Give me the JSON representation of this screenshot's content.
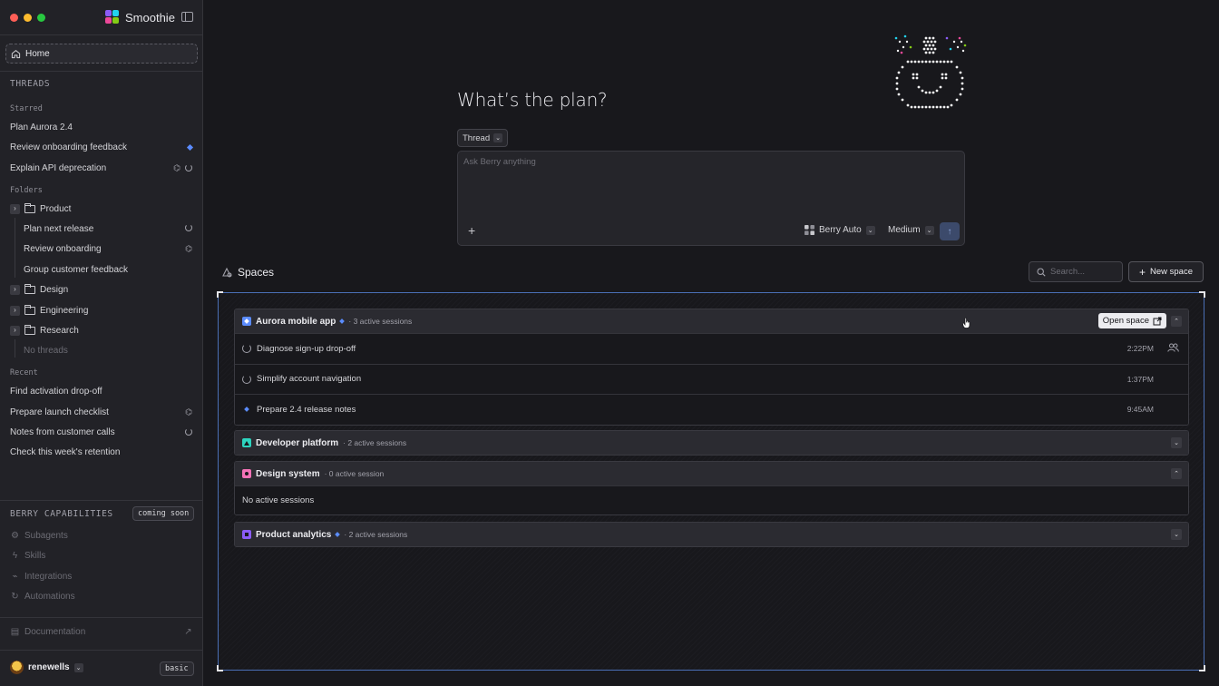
{
  "app": {
    "name": "Smoothie"
  },
  "sidebar": {
    "home_label": "Home",
    "threads_title": "THREADS",
    "starred_title": "Starred",
    "starred": [
      {
        "label": "Plan Aurora 2.4"
      },
      {
        "label": "Review onboarding feedback"
      },
      {
        "label": "Explain API deprecation"
      }
    ],
    "folders_title": "Folders",
    "folders": {
      "product": {
        "label": "Product",
        "items": [
          "Plan next release",
          "Review onboarding",
          "Group customer feedback"
        ]
      },
      "design": {
        "label": "Design"
      },
      "engineering": {
        "label": "Engineering"
      },
      "research": {
        "label": "Research",
        "empty": "No threads"
      }
    },
    "recent_title": "Recent",
    "recent": [
      {
        "label": "Find activation drop-off"
      },
      {
        "label": "Prepare launch checklist"
      },
      {
        "label": "Notes from customer calls"
      },
      {
        "label": "Check this week's retention"
      }
    ],
    "capabilities_title": "BERRY CAPABILITIES",
    "capabilities_badge": "coming soon",
    "capabilities": [
      "Subagents",
      "Skills",
      "Integrations",
      "Automations"
    ],
    "documentation": "Documentation",
    "user": {
      "name": "renewells",
      "plan": "basic"
    }
  },
  "composer": {
    "headline": "What’s the plan?",
    "mode": "Thread",
    "placeholder": "Ask Berry anything",
    "model": "Berry Auto",
    "effort": "Medium"
  },
  "spaces": {
    "title": "Spaces",
    "search_placeholder": "Search...",
    "new_space": "New space",
    "open_space": "Open space",
    "list": [
      {
        "name": "Aurora mobile app",
        "meta": "3 active sessions",
        "color": "#5b8cff",
        "sessions": [
          {
            "title": "Diagnose sign-up drop-off",
            "time": "2:22PM"
          },
          {
            "title": "Simplify account navigation",
            "time": "1:37PM"
          },
          {
            "title": "Prepare 2.4 release notes",
            "time": "9:45AM"
          }
        ]
      },
      {
        "name": "Developer platform",
        "meta": "2 active sessions",
        "color": "#2dd4bf"
      },
      {
        "name": "Design system",
        "meta": "0 active session",
        "color": "#f472b6",
        "empty": "No active sessions"
      },
      {
        "name": "Product analytics",
        "meta": "2 active sessions",
        "color": "#8b5cf6"
      }
    ]
  },
  "icons": [
    "home-icon",
    "folder-icon",
    "spinner-icon",
    "group-icon",
    "plus-icon",
    "send-icon",
    "search-icon",
    "external-link-icon",
    "chevron-icon"
  ]
}
